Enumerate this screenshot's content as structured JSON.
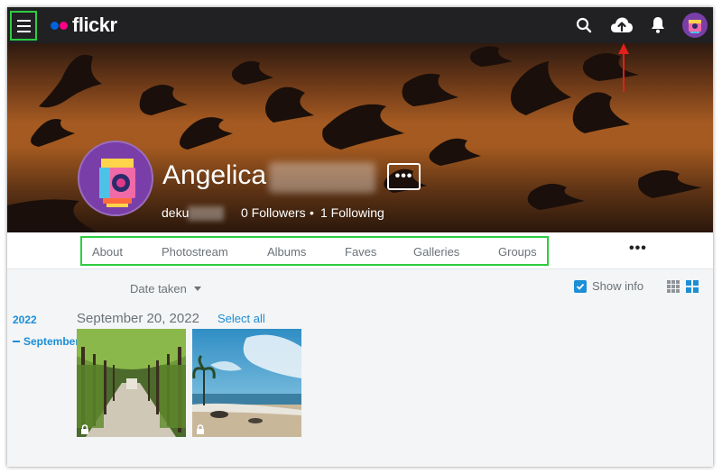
{
  "header": {
    "logo_text": "flickr",
    "icons": [
      "menu-icon",
      "search-icon",
      "upload-cloud-icon",
      "bell-icon",
      "user-avatar"
    ]
  },
  "profile": {
    "name": "Angelica",
    "username": "deku",
    "followers": "0 Followers",
    "separator": "•",
    "following": "1 Following",
    "more_label": "•••"
  },
  "tabs": [
    {
      "label": "About"
    },
    {
      "label": "Photostream"
    },
    {
      "label": "Albums"
    },
    {
      "label": "Faves"
    },
    {
      "label": "Galleries"
    },
    {
      "label": "Groups"
    }
  ],
  "tabs_more_label": "•••",
  "toolbar": {
    "sort_label": "Date taken",
    "show_info_label": "Show info",
    "show_info_checked": true
  },
  "timeline": {
    "year": "2022",
    "month": "September"
  },
  "section": {
    "date": "September 20, 2022",
    "select_all": "Select all"
  },
  "photos": [
    {
      "name": "tree-lined-path",
      "private": true
    },
    {
      "name": "beach-with-palm",
      "private": true
    }
  ],
  "colors": {
    "topbar": "#212124",
    "accent_blue": "#1c8ed6",
    "highlight_green": "#2ecc40",
    "annotation_red": "#e0201b",
    "flickr_blue": "#0063dc",
    "flickr_pink": "#ff0084"
  }
}
